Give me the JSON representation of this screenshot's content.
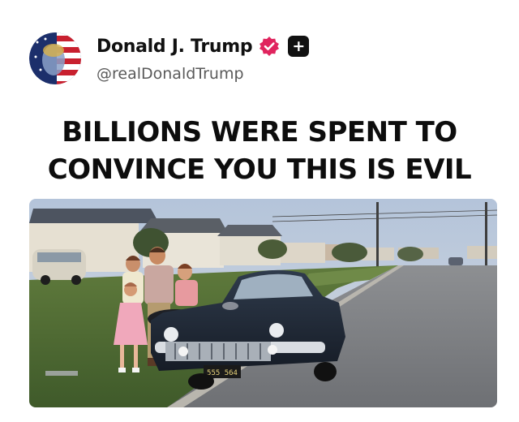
{
  "post": {
    "author": {
      "display_name": "Donald J. Trump",
      "handle": "@realDonaldTrump",
      "verified_icon": "verified-badge-icon",
      "verified_color": "#e0245e",
      "follow_icon": "plus-icon"
    },
    "headline_lines": [
      "BILLIONS WERE SPENT TO",
      "CONVINCE YOU THIS IS EVIL"
    ],
    "image": {
      "plate_text": "555 564"
    }
  }
}
